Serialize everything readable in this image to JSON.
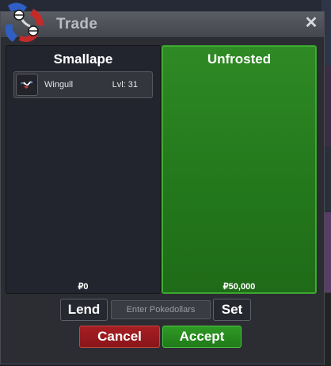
{
  "window": {
    "title": "Trade"
  },
  "left_panel": {
    "player_name": "Smallape",
    "items": [
      {
        "name": "Wingull",
        "level": "Lvl: 31",
        "icon": "wingull-sprite-icon"
      }
    ],
    "money": "₽0"
  },
  "right_panel": {
    "player_name": "Unfrosted",
    "money": "₽50,000"
  },
  "controls": {
    "lend_label": "Lend",
    "pokedollar_placeholder": "Enter Pokedollars",
    "set_label": "Set",
    "cancel_label": "Cancel",
    "accept_label": "Accept"
  },
  "colors": {
    "accent_green": "#2f8a25",
    "cancel_red": "#a61e22",
    "panel_dark": "#23252e"
  }
}
